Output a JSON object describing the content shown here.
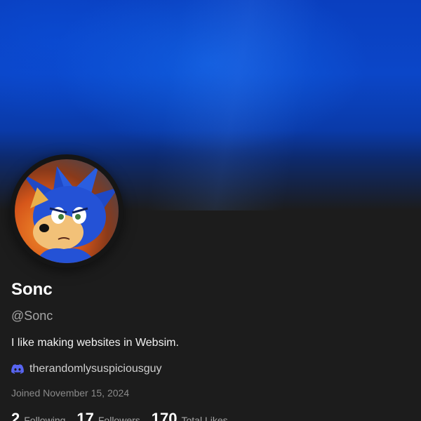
{
  "profile": {
    "display_name": "Sonc",
    "handle": "@Sonc",
    "bio": "I like making websites in Websim.",
    "discord_username": "therandomlysuspiciousguy",
    "joined": "Joined November 15, 2024"
  },
  "stats": {
    "following": {
      "count": "2",
      "label": "Following"
    },
    "followers": {
      "count": "17",
      "label": "Followers"
    },
    "likes": {
      "count": "170",
      "label": "Total Likes"
    }
  },
  "icons": {
    "discord": "discord-icon"
  },
  "colors": {
    "banner_blue": "#0b46c8",
    "background": "#1c1c1c",
    "discord_purple": "#5865f2",
    "muted_text": "#a5a5a5"
  }
}
